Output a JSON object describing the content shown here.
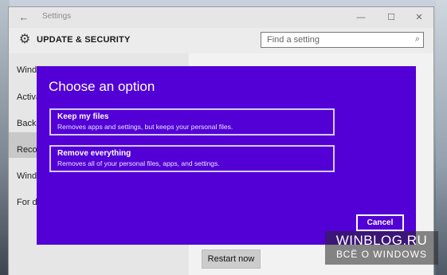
{
  "window": {
    "title": "Settings",
    "back_icon": "←",
    "minimize_icon": "—",
    "maximize_icon": "☐",
    "close_icon": "✕"
  },
  "header": {
    "title": "UPDATE & SECURITY",
    "gear_icon": "⚙",
    "search_placeholder": "Find a setting",
    "search_icon": "⌕"
  },
  "sidebar": {
    "items": [
      {
        "label": "Windows Update"
      },
      {
        "label": "Activa"
      },
      {
        "label": "Backu"
      },
      {
        "label": "Recov"
      },
      {
        "label": "Windo"
      },
      {
        "label": "For de"
      }
    ]
  },
  "content": {
    "restart_label": "Restart now"
  },
  "dialog": {
    "title": "Choose an option",
    "background": "#5200d6",
    "options": [
      {
        "title": "Keep my files",
        "description": "Removes apps and settings, but keeps your personal files."
      },
      {
        "title": "Remove everything",
        "description": "Removes all of your personal files, apps, and settings."
      }
    ],
    "cancel_label": "Cancel"
  },
  "watermark": {
    "line1": "WINBLOG.RU",
    "line2": "ВСЁ О WINDOWS"
  }
}
